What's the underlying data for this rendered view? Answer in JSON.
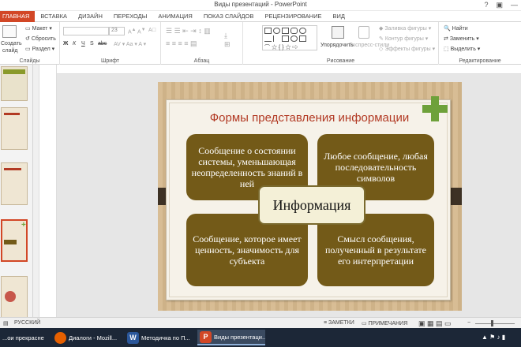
{
  "window": {
    "title": "Виды презентаций - PowerPoint"
  },
  "tabs": [
    "ГЛАВНАЯ",
    "ВСТАВКА",
    "ДИЗАЙН",
    "ПЕРЕХОДЫ",
    "АНИМАЦИЯ",
    "ПОКАЗ СЛАЙДОВ",
    "РЕЦЕНЗИРОВАНИЕ",
    "ВИД"
  ],
  "ribbon": {
    "slides": {
      "new": "Создать",
      "new2": "слайд",
      "layout": "Макет",
      "reset": "Сбросить",
      "section": "Раздел",
      "label": "Слайды"
    },
    "font": {
      "size": "23",
      "label": "Шрифт",
      "bold": "Ж",
      "italic": "К",
      "underline": "Ч",
      "strike": "S",
      "abc": "abc"
    },
    "paragraph": {
      "label": "Абзац"
    },
    "drawing": {
      "arrange": "Упорядочить",
      "styles": "Экспресс-стили",
      "fill": "Заливка фигуры",
      "outline": "Контур фигуры",
      "effects": "Эффекты фигуры",
      "label": "Рисование"
    },
    "editing": {
      "find": "Найти",
      "replace": "Заменить",
      "select": "Выделить",
      "label": "Редактирование"
    }
  },
  "slide": {
    "title": "Формы представления информации",
    "center": "Информация",
    "box_tl": "Сообщение о состоянии системы, уменьшающая неопределенность знаний в ней",
    "box_tr": "Любое сообщение, любая последовательность символов",
    "box_bl": "Сообщение, которое имеет ценность, значимость для субъекта",
    "box_br": "Смысл сообщения, полученный в результате его интерпретации"
  },
  "thumb_numbers": [
    "",
    "",
    "",
    "",
    ""
  ],
  "status": {
    "language": "РУССКИЙ",
    "notes": "ЗАМЕТКИ",
    "comments": "ПРИМЕЧАНИЯ"
  },
  "taskbar": {
    "items": [
      "...ои прекрасней...",
      "Диалоги - Mozill...",
      "Методичка по П...",
      "Виды презентаци..."
    ]
  },
  "colors": {
    "accent": "#d24726",
    "box": "#735a18",
    "title": "#b23a24",
    "plus": "#6ea13a"
  }
}
